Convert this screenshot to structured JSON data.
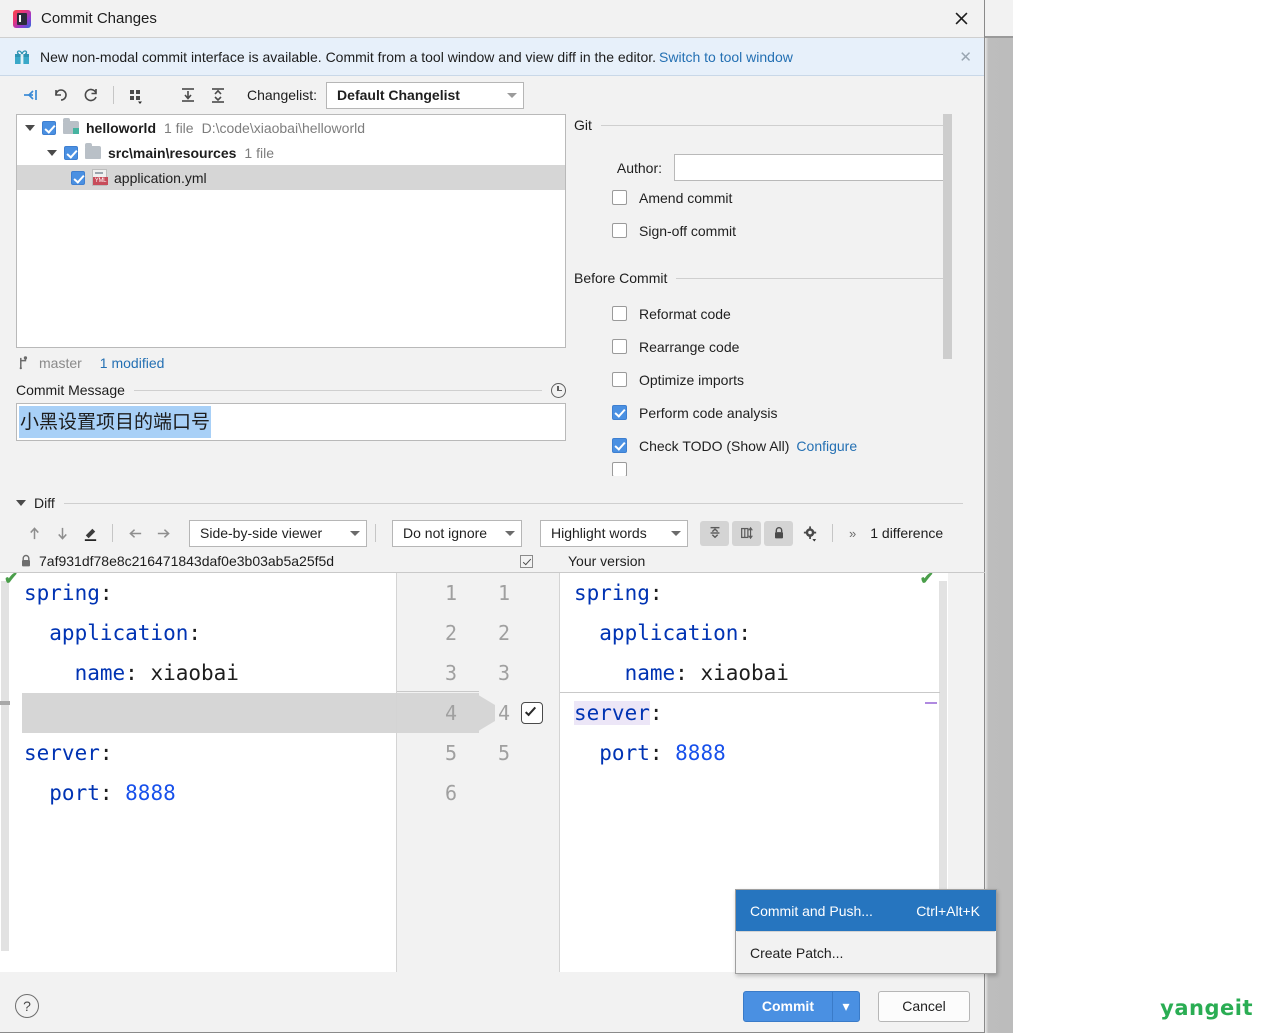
{
  "window": {
    "title": "Commit Changes",
    "close_label": "✕",
    "app_icon": "intellij-idea-icon"
  },
  "banner": {
    "icon": "gift-icon",
    "text": "New non-modal commit interface is available. Commit from a tool window and view diff in the editor.",
    "link": "Switch to tool window",
    "close_label": "✕"
  },
  "toolbar": {
    "icons": [
      "show-diff-icon",
      "revert-icon",
      "refresh-icon",
      "group-by-icon",
      "expand-all-icon",
      "collapse-all-icon"
    ],
    "changelist_label": "Changelist:",
    "changelist_value": "Default Changelist"
  },
  "tree": {
    "rows": [
      {
        "name": "helloworld",
        "meta": "1 file",
        "path": "D:\\code\\xiaobai\\helloworld",
        "checked": true,
        "selected": false,
        "kind": "project"
      },
      {
        "name": "src\\main\\resources",
        "meta": "1 file",
        "path": "",
        "checked": true,
        "selected": false,
        "kind": "folder"
      },
      {
        "name": "application.yml",
        "meta": "",
        "path": "",
        "checked": true,
        "selected": true,
        "kind": "yml"
      }
    ]
  },
  "status": {
    "branch": "master",
    "modified": "1 modified",
    "branch_icon": "git-branch-icon"
  },
  "commit_message": {
    "label": "Commit Message",
    "history_icon": "history-clock-icon",
    "value": "小黑设置项目的端口号"
  },
  "git_panel": {
    "title": "Git",
    "author_label": "Author:",
    "author_value": "",
    "author_placeholder": "",
    "options": [
      {
        "label": "Amend commit",
        "checked": false
      },
      {
        "label": "Sign-off commit",
        "checked": false
      }
    ]
  },
  "before_commit": {
    "title": "Before Commit",
    "options": [
      {
        "label": "Reformat code",
        "checked": false,
        "link": ""
      },
      {
        "label": "Rearrange code",
        "checked": false,
        "link": ""
      },
      {
        "label": "Optimize imports",
        "checked": false,
        "link": ""
      },
      {
        "label": "Perform code analysis",
        "checked": true,
        "link": ""
      },
      {
        "label": "Check TODO (Show All)",
        "checked": true,
        "link": "Configure"
      }
    ]
  },
  "diff": {
    "section_label": "Diff",
    "nav_icons": [
      "prev-difference-icon",
      "next-difference-icon",
      "edit-icon",
      "accept-left-icon",
      "accept-right-icon"
    ],
    "viewer_mode": "Side-by-side viewer",
    "ignore_mode": "Do not ignore",
    "highlight_mode": "Highlight words",
    "toggle_icons": [
      "collapse-unchanged-icon",
      "synchronize-scrolling-icon",
      "lock-icon",
      "settings-gear-icon"
    ],
    "overflow_label": "»",
    "difference_count": "1 difference",
    "left_title": "7af931df78e8c216471843daf0e3b03ab5a25f5d",
    "left_title_icon": "lock-icon",
    "right_title": "Your version",
    "right_title_checked": true,
    "left_lines": [
      {
        "num": "1",
        "segments": [
          {
            "t": "spring",
            "c": "kw"
          },
          {
            "t": ":",
            "c": "txt"
          }
        ]
      },
      {
        "num": "2",
        "segments": [
          {
            "t": "  application",
            "c": "kw"
          },
          {
            "t": ":",
            "c": "txt"
          }
        ]
      },
      {
        "num": "3",
        "segments": [
          {
            "t": "    name",
            "c": "kw"
          },
          {
            "t": ": ",
            "c": "txt"
          },
          {
            "t": "xiaobai",
            "c": "txt"
          }
        ]
      },
      {
        "num": "4",
        "segments": []
      },
      {
        "num": "5",
        "segments": [
          {
            "t": "server",
            "c": "kw"
          },
          {
            "t": ":",
            "c": "txt"
          }
        ]
      },
      {
        "num": "6",
        "segments": [
          {
            "t": "  port",
            "c": "kw"
          },
          {
            "t": ": ",
            "c": "txt"
          },
          {
            "t": "8888",
            "c": "num"
          }
        ]
      }
    ],
    "right_lines": [
      {
        "num": "1",
        "segments": [
          {
            "t": "spring",
            "c": "kw"
          },
          {
            "t": ":",
            "c": "txt"
          }
        ]
      },
      {
        "num": "2",
        "segments": [
          {
            "t": "  application",
            "c": "kw"
          },
          {
            "t": ":",
            "c": "txt"
          }
        ]
      },
      {
        "num": "3",
        "segments": [
          {
            "t": "    name",
            "c": "kw"
          },
          {
            "t": ": ",
            "c": "txt"
          },
          {
            "t": "xiaobai",
            "c": "txt"
          }
        ]
      },
      {
        "num": "4",
        "segments": [
          {
            "t": "server",
            "c": "kw hl"
          },
          {
            "t": ":",
            "c": "txt"
          }
        ]
      },
      {
        "num": "5",
        "segments": [
          {
            "t": "  port",
            "c": "kw"
          },
          {
            "t": ": ",
            "c": "txt"
          },
          {
            "t": "8888",
            "c": "num"
          }
        ]
      }
    ],
    "accept_change_checked": true
  },
  "context_menu": {
    "items": [
      {
        "label": "Commit and Push...",
        "shortcut": "Ctrl+Alt+K",
        "active": true
      },
      {
        "label": "Create Patch...",
        "shortcut": "",
        "active": false
      }
    ]
  },
  "footer": {
    "help_label": "?",
    "commit_label": "Commit",
    "commit_arrow": "▾",
    "cancel_label": "Cancel"
  },
  "watermark": {
    "text": "yangeit",
    "color": "#2aad53"
  },
  "colors": {
    "accent_blue": "#4a90e2",
    "link_blue": "#2470b3",
    "menu_highlight": "#2675bf",
    "selection_blue": "#a8d0f7",
    "keyword": "#0033b3",
    "number": "#1750eb"
  }
}
